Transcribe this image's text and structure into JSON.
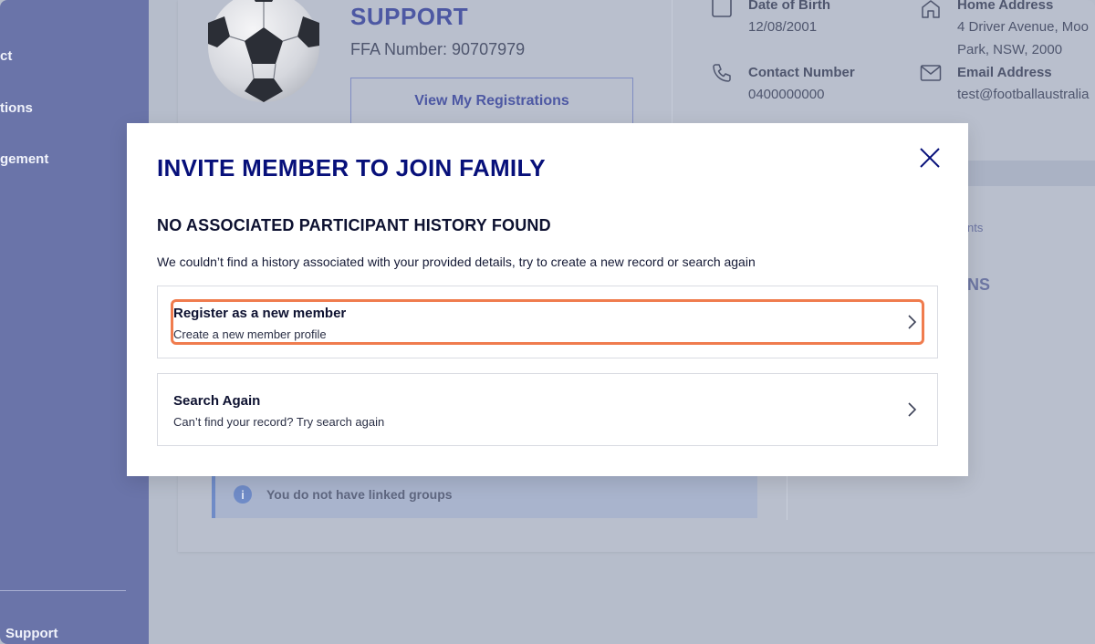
{
  "sidebar": {
    "items": [
      {
        "label": "ct"
      },
      {
        "label": "tions"
      },
      {
        "label": "gement"
      },
      {
        "label": "Support"
      }
    ]
  },
  "profile": {
    "title": "SUPPORT",
    "ffa_number": "FFA Number: 90707979",
    "view_registrations_label": "View My Registrations"
  },
  "details": {
    "dob_label": "Date of Birth",
    "dob_value": "12/08/2001",
    "contact_label": "Contact Number",
    "contact_value": "0400000000",
    "address_label": "Home Address",
    "address_line1": "4 Driver Avenue, Moo",
    "address_line2": "Park, NSW, 2000",
    "email_label": "Email Address",
    "email_value": "test@footballaustralia"
  },
  "background": {
    "frag_nts": "nts",
    "frag_ns": "NS",
    "linked_groups_text": "You do not have linked groups",
    "info_glyph": "i"
  },
  "modal": {
    "title": "INVITE MEMBER TO JOIN FAMILY",
    "subtitle": "NO ASSOCIATED PARTICIPANT HISTORY FOUND",
    "description": "We couldn’t find a history associated with your provided details, try to create a new record or search again",
    "options": [
      {
        "title": "Register as a new member",
        "subtitle": "Create a new member profile",
        "highlighted": true
      },
      {
        "title": "Search Again",
        "subtitle": "Can’t find your record? Try search again",
        "highlighted": false
      }
    ]
  },
  "icons": {
    "close": "close-icon",
    "chevron": "chevron-right-icon",
    "calendar": "calendar-icon",
    "phone": "phone-icon",
    "home": "home-icon",
    "mail": "mail-icon"
  },
  "colors": {
    "brand_navy": "#07107a",
    "highlight": "#f07c4e",
    "sidebar": "#6a74a9"
  }
}
